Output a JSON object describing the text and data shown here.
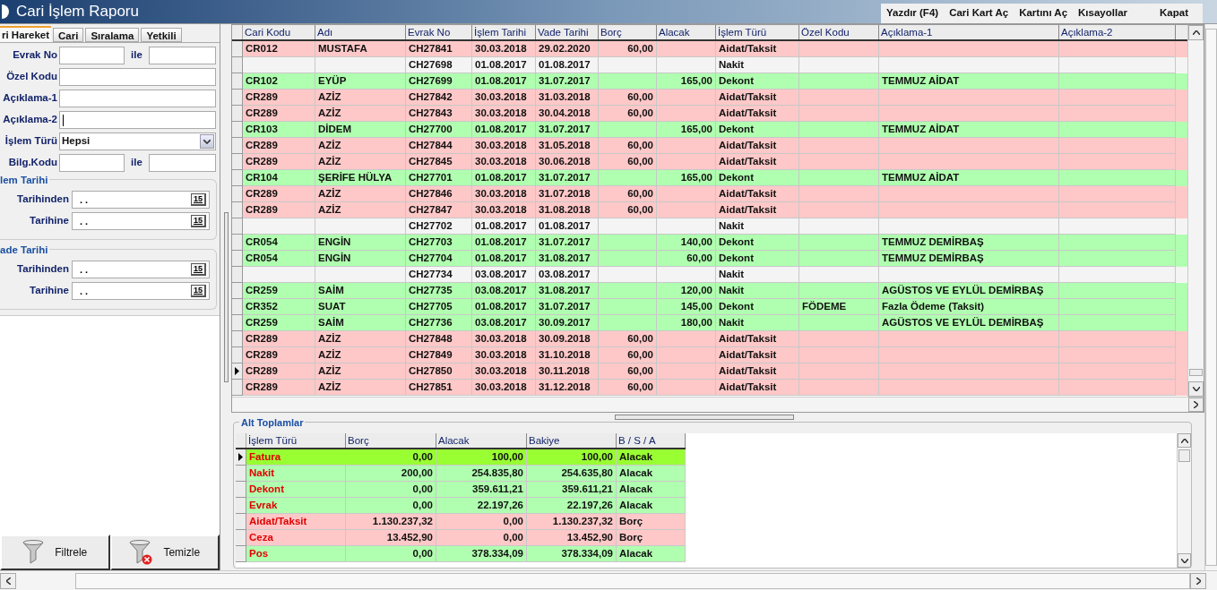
{
  "window": {
    "title": "Cari İşlem Raporu"
  },
  "menu": [
    "Yazdır (F4)",
    "Cari Kart Aç",
    "Kartını Aç",
    "Kısayollar",
    "Kapat"
  ],
  "tabs": [
    {
      "label": "ri Hareket",
      "selected": true
    },
    {
      "label": "Cari",
      "selected": false
    },
    {
      "label": "Sıralama",
      "selected": false
    },
    {
      "label": "Yetkili",
      "selected": false
    }
  ],
  "filters": [
    {
      "kind": "range",
      "label": "Evrak No",
      "joiner": "ile"
    },
    {
      "kind": "text",
      "label": "Özel Kodu"
    },
    {
      "kind": "text",
      "label": "Açıklama-1"
    },
    {
      "kind": "text",
      "label": "Açıklama-2",
      "focused": true
    },
    {
      "kind": "select",
      "label": "İşlem Türü",
      "value": "Hepsi"
    },
    {
      "kind": "range",
      "label": "Bilg.Kodu",
      "joiner": "ile"
    }
  ],
  "date_groups": [
    {
      "title": "lem Tarihi",
      "fields": [
        {
          "label": "Tarihinden",
          "value": ". .",
          "button": "15"
        },
        {
          "label": "Tarihine",
          "value": ". .",
          "button": "15"
        }
      ]
    },
    {
      "title": "ade Tarihi",
      "fields": [
        {
          "label": "Tarihinden",
          "value": ". .",
          "button": "15"
        },
        {
          "label": "Tarihine",
          "value": ". .",
          "button": "15"
        }
      ]
    }
  ],
  "buttons": [
    {
      "kind": "filter",
      "label": "Filtrele"
    },
    {
      "kind": "clear",
      "label": "Temizle"
    }
  ],
  "table": {
    "columns": [
      "Cari Kodu",
      "Adı",
      "Evrak No",
      "İşlem Tarihi",
      "Vade Tarihi",
      "Borç",
      "Alacak",
      "İşlem Türü",
      "Özel Kodu",
      "Açıklama-1",
      "Açıklama-2"
    ],
    "rows": [
      {
        "color": "#ffc8c8",
        "selected": false,
        "cells": [
          "CR012",
          "MUSTAFA",
          "CH27841",
          "30.03.2018",
          "29.02.2020",
          "60,00",
          "",
          "Aidat/Taksit",
          "",
          "",
          ""
        ]
      },
      {
        "color": "#f4f4f4",
        "selected": false,
        "cells": [
          "",
          "",
          "CH27698",
          "01.08.2017",
          "01.08.2017",
          "",
          "",
          "Nakit",
          "",
          "",
          ""
        ]
      },
      {
        "color": "#b0ffb0",
        "selected": false,
        "cells": [
          "CR102",
          "EYÜP",
          "CH27699",
          "01.08.2017",
          "31.07.2017",
          "",
          "165,00",
          "Dekont",
          "",
          "TEMMUZ AİDAT",
          ""
        ]
      },
      {
        "color": "#ffc8c8",
        "selected": false,
        "cells": [
          "CR289",
          "AZİZ",
          "CH27842",
          "30.03.2018",
          "31.03.2018",
          "60,00",
          "",
          "Aidat/Taksit",
          "",
          "",
          ""
        ]
      },
      {
        "color": "#ffc8c8",
        "selected": false,
        "cells": [
          "CR289",
          "AZİZ",
          "CH27843",
          "30.03.2018",
          "30.04.2018",
          "60,00",
          "",
          "Aidat/Taksit",
          "",
          "",
          ""
        ]
      },
      {
        "color": "#b0ffb0",
        "selected": false,
        "cells": [
          "CR103",
          "DİDEM",
          "CH27700",
          "01.08.2017",
          "31.07.2017",
          "",
          "165,00",
          "Dekont",
          "",
          "TEMMUZ AİDAT",
          ""
        ]
      },
      {
        "color": "#ffc8c8",
        "selected": false,
        "cells": [
          "CR289",
          "AZİZ",
          "CH27844",
          "30.03.2018",
          "31.05.2018",
          "60,00",
          "",
          "Aidat/Taksit",
          "",
          "",
          ""
        ]
      },
      {
        "color": "#ffc8c8",
        "selected": false,
        "cells": [
          "CR289",
          "AZİZ",
          "CH27845",
          "30.03.2018",
          "30.06.2018",
          "60,00",
          "",
          "Aidat/Taksit",
          "",
          "",
          ""
        ]
      },
      {
        "color": "#b0ffb0",
        "selected": false,
        "cells": [
          "CR104",
          "ŞERİFE HÜLYA",
          "CH27701",
          "01.08.2017",
          "31.07.2017",
          "",
          "165,00",
          "Dekont",
          "",
          "TEMMUZ AİDAT",
          ""
        ]
      },
      {
        "color": "#ffc8c8",
        "selected": false,
        "cells": [
          "CR289",
          "AZİZ",
          "CH27846",
          "30.03.2018",
          "31.07.2018",
          "60,00",
          "",
          "Aidat/Taksit",
          "",
          "",
          ""
        ]
      },
      {
        "color": "#ffc8c8",
        "selected": false,
        "cells": [
          "CR289",
          "AZİZ",
          "CH27847",
          "30.03.2018",
          "31.08.2018",
          "60,00",
          "",
          "Aidat/Taksit",
          "",
          "",
          ""
        ]
      },
      {
        "color": "#f4f4f4",
        "selected": false,
        "cells": [
          "",
          "",
          "CH27702",
          "01.08.2017",
          "01.08.2017",
          "",
          "",
          "Nakit",
          "",
          "",
          ""
        ]
      },
      {
        "color": "#b0ffb0",
        "selected": false,
        "cells": [
          "CR054",
          "ENGİN",
          "CH27703",
          "01.08.2017",
          "31.07.2017",
          "",
          "140,00",
          "Dekont",
          "",
          "TEMMUZ DEMİRBAŞ",
          ""
        ]
      },
      {
        "color": "#b0ffb0",
        "selected": false,
        "cells": [
          "CR054",
          "ENGİN",
          "CH27704",
          "01.08.2017",
          "31.08.2017",
          "",
          "60,00",
          "Dekont",
          "",
          "TEMMUZ DEMİRBAŞ",
          ""
        ]
      },
      {
        "color": "#f4f4f4",
        "selected": false,
        "cells": [
          "",
          "",
          "CH27734",
          "03.08.2017",
          "03.08.2017",
          "",
          "",
          "Nakit",
          "",
          "",
          ""
        ]
      },
      {
        "color": "#b0ffb0",
        "selected": false,
        "cells": [
          "CR259",
          "SAİM",
          "CH27735",
          "03.08.2017",
          "31.08.2017",
          "",
          "120,00",
          "Nakit",
          "",
          "AGÜSTOS VE EYLÜL DEMİRBAŞ",
          ""
        ]
      },
      {
        "color": "#b0ffb0",
        "selected": false,
        "cells": [
          "CR352",
          "SUAT",
          "CH27705",
          "01.08.2017",
          "31.07.2017",
          "",
          "145,00",
          "Dekont",
          "FÖDEME",
          "Fazla Ödeme (Taksit)",
          ""
        ]
      },
      {
        "color": "#b0ffb0",
        "selected": false,
        "cells": [
          "CR259",
          "SAİM",
          "CH27736",
          "03.08.2017",
          "30.09.2017",
          "",
          "180,00",
          "Nakit",
          "",
          "AGÜSTOS VE EYLÜL DEMİRBAŞ",
          ""
        ]
      },
      {
        "color": "#ffc8c8",
        "selected": false,
        "cells": [
          "CR289",
          "AZİZ",
          "CH27848",
          "30.03.2018",
          "30.09.2018",
          "60,00",
          "",
          "Aidat/Taksit",
          "",
          "",
          ""
        ]
      },
      {
        "color": "#ffc8c8",
        "selected": false,
        "cells": [
          "CR289",
          "AZİZ",
          "CH27849",
          "30.03.2018",
          "31.10.2018",
          "60,00",
          "",
          "Aidat/Taksit",
          "",
          "",
          ""
        ]
      },
      {
        "color": "#ffc8c8",
        "selected": true,
        "cells": [
          "CR289",
          "AZİZ",
          "CH27850",
          "30.03.2018",
          "30.11.2018",
          "60,00",
          "",
          "Aidat/Taksit",
          "",
          "",
          ""
        ]
      },
      {
        "color": "#ffc8c8",
        "selected": false,
        "cells": [
          "CR289",
          "AZİZ",
          "CH27851",
          "30.03.2018",
          "31.12.2018",
          "60,00",
          "",
          "Aidat/Taksit",
          "",
          "",
          ""
        ]
      }
    ]
  },
  "subtotals": {
    "title": "Alt Toplamlar",
    "columns": [
      "İşlem Türü",
      "Borç",
      "Alacak",
      "Bakiye",
      "B / S / A"
    ],
    "rows": [
      {
        "color": "#99ff33",
        "selected": true,
        "cells": [
          "Fatura",
          "0,00",
          "100,00",
          "100,00",
          "Alacak"
        ]
      },
      {
        "color": "#b0ffb0",
        "selected": false,
        "cells": [
          "Nakit",
          "200,00",
          "254.835,80",
          "254.635,80",
          "Alacak"
        ]
      },
      {
        "color": "#b0ffb0",
        "selected": false,
        "cells": [
          "Dekont",
          "0,00",
          "359.611,21",
          "359.611,21",
          "Alacak"
        ]
      },
      {
        "color": "#b0ffb0",
        "selected": false,
        "cells": [
          "Evrak",
          "0,00",
          "22.197,26",
          "22.197,26",
          "Alacak"
        ]
      },
      {
        "color": "#ffc8c8",
        "selected": false,
        "cells": [
          "Aidat/Taksit",
          "1.130.237,32",
          "0,00",
          "1.130.237,32",
          "Borç"
        ]
      },
      {
        "color": "#ffc8c8",
        "selected": false,
        "cells": [
          "Ceza",
          "13.452,90",
          "0,00",
          "13.452,90",
          "Borç"
        ]
      },
      {
        "color": "#b0ffb0",
        "selected": false,
        "cells": [
          "Pos",
          "0,00",
          "378.334,09",
          "378.334,09",
          "Alacak"
        ]
      }
    ]
  }
}
